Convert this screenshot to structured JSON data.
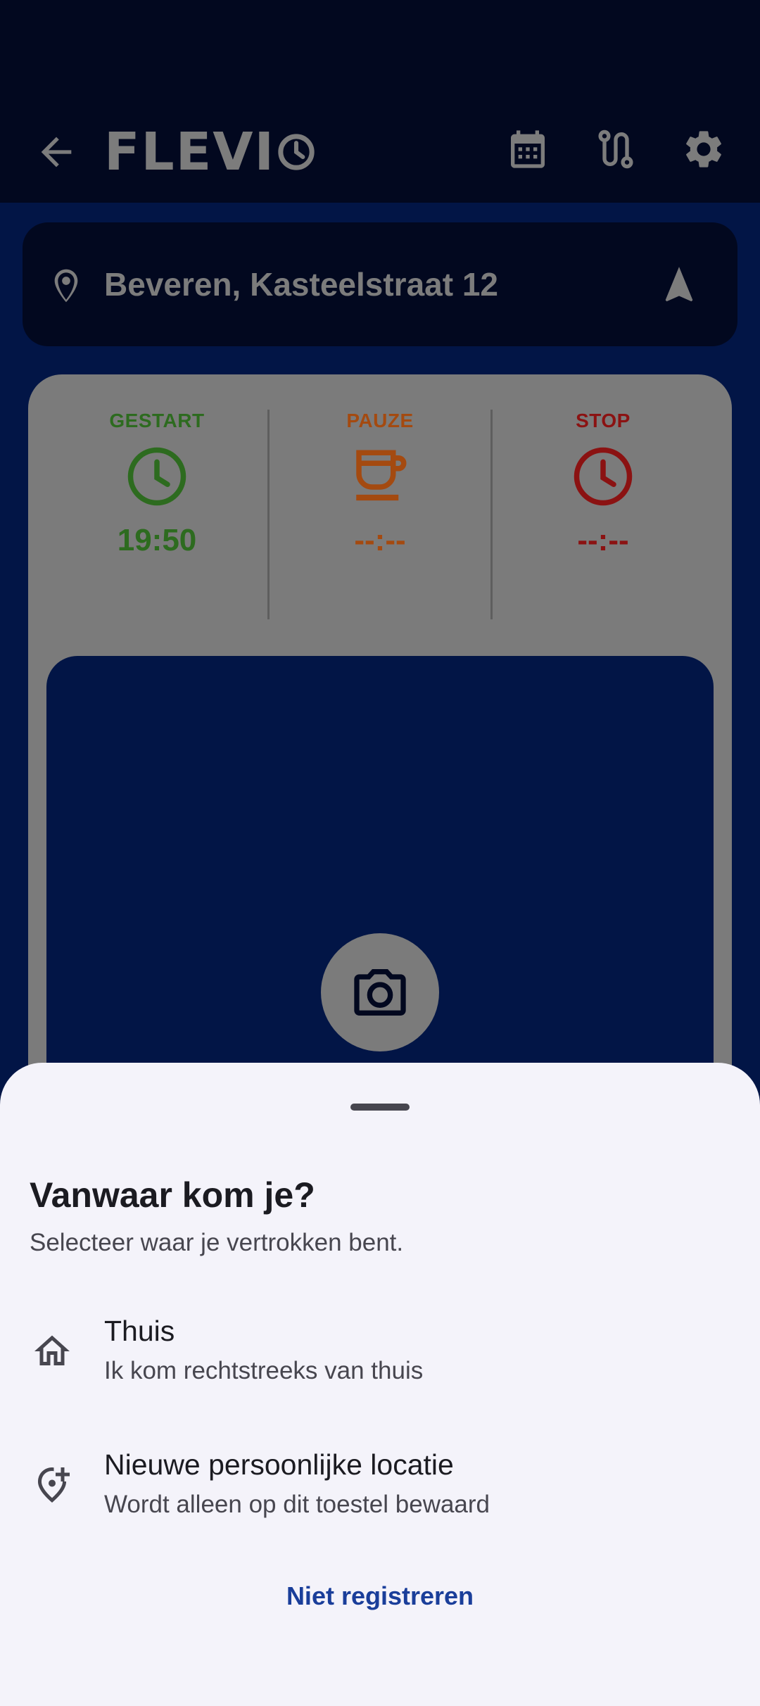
{
  "app": {
    "logo_text": "FLEVI"
  },
  "location": {
    "address": "Beveren, Kasteelstraat 12"
  },
  "timer": {
    "columns": [
      {
        "label": "GESTART",
        "time": "19:50",
        "color": "#2d6b1f"
      },
      {
        "label": "PAUZE",
        "time": "--:--",
        "color": "#a44a10"
      },
      {
        "label": "STOP",
        "time": "--:--",
        "color": "#8b1212"
      }
    ]
  },
  "sheet": {
    "title": "Vanwaar kom je?",
    "subtitle": "Selecteer waar je vertrokken bent.",
    "options": [
      {
        "title": "Thuis",
        "subtitle": "Ik kom rechtstreeks van thuis",
        "icon": "home-icon"
      },
      {
        "title": "Nieuwe persoonlijke locatie",
        "subtitle": "Wordt alleen op dit toestel bewaard",
        "icon": "add-location-icon"
      }
    ],
    "dismiss_label": "Niet registreren"
  },
  "colors": {
    "scrim_bg": "#02081f",
    "primary": "#021546",
    "sheet_bg": "#f4f3fa",
    "accent_link": "#1a3e9a"
  }
}
